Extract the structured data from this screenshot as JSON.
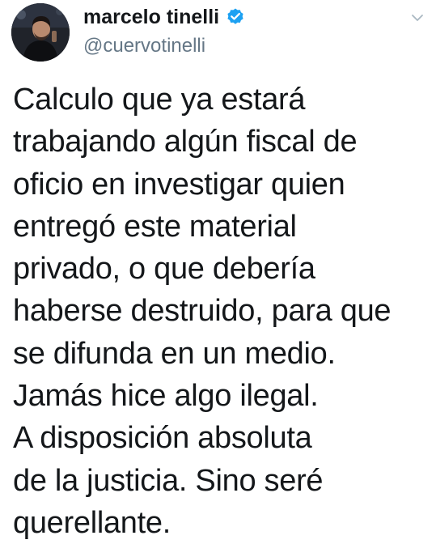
{
  "tweet": {
    "author": {
      "display_name": "marcelo tinelli",
      "handle": "@cuervotinelli",
      "verified": true,
      "avatar_icon": "profile-photo",
      "verified_icon": "verified-badge-icon",
      "verified_color": "#1da1f2"
    },
    "menu_icon": "chevron-down-icon",
    "text_lines": [
      "Calculo que ya estará",
      "trabajando algún fiscal de",
      "oficio en investigar quien",
      "entregó este material",
      "privado, o que debería",
      "haberse destruido, para que",
      "se difunda en un medio.",
      "Jamás hice algo ilegal.",
      "A disposición absoluta",
      "de la justicia. Sino seré",
      "querellante."
    ]
  }
}
